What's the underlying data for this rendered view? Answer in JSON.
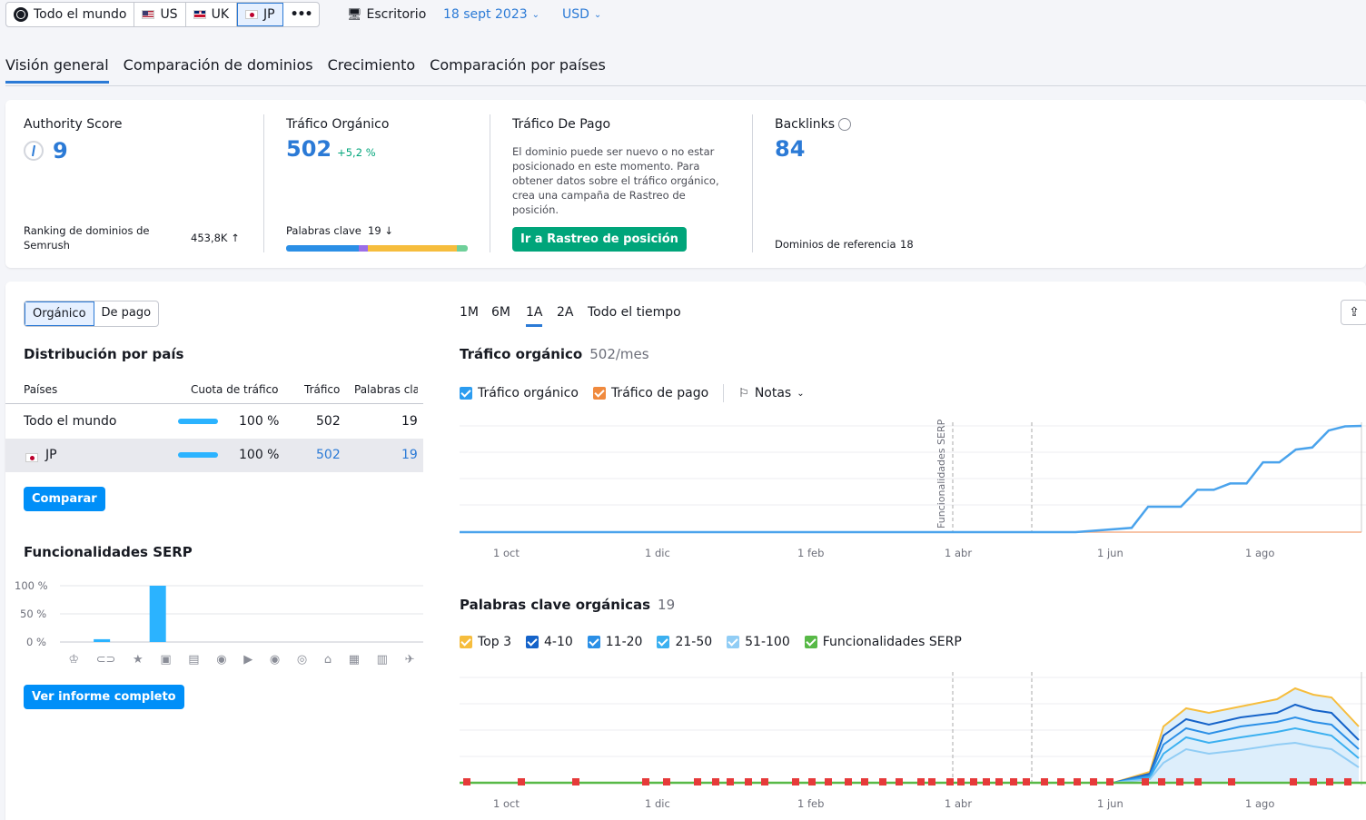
{
  "topbar": {
    "regions": [
      {
        "label": "Todo el mundo",
        "icon": "globe-icon"
      },
      {
        "label": "US",
        "icon": "flag-us-icon"
      },
      {
        "label": "UK",
        "icon": "flag-uk-icon"
      },
      {
        "label": "JP",
        "icon": "flag-jp-icon",
        "active": true
      }
    ],
    "more": "•••",
    "device": "Escritorio",
    "date": "18 sept 2023",
    "currency": "USD"
  },
  "tabs": [
    "Visión general",
    "Comparación de dominios",
    "Crecimiento",
    "Comparación por países"
  ],
  "summary": {
    "authority": {
      "title": "Authority Score",
      "value": "9",
      "rank_label": "Ranking de dominios de Semrush",
      "rank_value": "453,8K ↑"
    },
    "organic": {
      "title": "Tráfico Orgánico",
      "value": "502",
      "change": "+5,2 %",
      "kw_label": "Palabras clave",
      "kw_value": "19 ↓"
    },
    "paid": {
      "title": "Tráfico De Pago",
      "text": "El dominio puede ser nuevo o no estar posicionado en este momento. Para obtener datos sobre el tráfico orgánico, crea una campaña de Rastreo de posición.",
      "button": "Ir a Rastreo de posición"
    },
    "backlinks": {
      "title": "Backlinks",
      "value": "84",
      "ref_label": "Dominios de referencia",
      "ref_value": "18"
    }
  },
  "left": {
    "toggle": [
      "Orgánico",
      "De pago"
    ],
    "dist_title": "Distribución por país",
    "headers": [
      "Países",
      "Cuota de tráfico",
      "Tráfico",
      "Palabras cla"
    ],
    "rows": [
      {
        "country": "Todo el mundo",
        "share": "100 %",
        "traffic": "502",
        "keywords": "19"
      },
      {
        "country": "JP",
        "share": "100 %",
        "traffic": "502",
        "keywords": "19"
      }
    ],
    "compare": "Comparar",
    "serp_title": "Funcionalidades SERP",
    "serp_yticks": [
      "100 %",
      "50 %",
      "0 %"
    ],
    "report_button": "Ver informe completo"
  },
  "right": {
    "periods": [
      "1M",
      "6M",
      "1A",
      "2A",
      "Todo el tiempo"
    ],
    "traffic_title": "Tráfico orgánico",
    "traffic_sub": "502/mes",
    "legend1": [
      "Tráfico orgánico",
      "Tráfico de pago"
    ],
    "notes": "Notas",
    "serp_marker": "Funcionalidades SERP",
    "xticks": [
      "1 oct",
      "1 dic",
      "1 feb",
      "1 abr",
      "1 jun",
      "1 ago"
    ],
    "kw_title": "Palabras clave orgánicas",
    "kw_sub": "19",
    "legend2": [
      "Top 3",
      "4-10",
      "11-20",
      "21-50",
      "51-100",
      "Funcionalidades SERP"
    ]
  },
  "colors": {
    "accent": "#2b7ad6",
    "green": "#00a57a",
    "button": "#008ff8"
  },
  "chart_data": [
    {
      "type": "bar",
      "title": "Funcionalidades SERP",
      "categories": [
        "1",
        "2",
        "3",
        "4",
        "5",
        "6",
        "7",
        "8",
        "9",
        "10",
        "11",
        "12",
        "13"
      ],
      "values": [
        0,
        5,
        0,
        100,
        0,
        0,
        0,
        0,
        0,
        0,
        0,
        0,
        0
      ],
      "ylim": [
        0,
        100
      ]
    },
    {
      "type": "line",
      "title": "Tráfico orgánico",
      "series": [
        {
          "name": "Tráfico orgánico",
          "values": [
            0,
            0,
            0,
            0,
            0,
            0,
            0,
            0,
            0,
            0,
            0,
            0,
            20,
            120,
            120,
            120,
            200,
            200,
            230,
            230,
            330,
            330,
            390,
            400,
            480,
            500,
            502
          ]
        },
        {
          "name": "Tráfico de pago",
          "values": [
            0,
            0,
            0,
            0,
            0,
            0,
            0,
            0,
            0,
            0,
            0,
            0,
            0,
            0,
            0,
            0,
            0,
            0,
            0,
            0,
            0,
            0,
            0,
            0,
            0,
            0,
            0
          ]
        }
      ]
    }
  ]
}
